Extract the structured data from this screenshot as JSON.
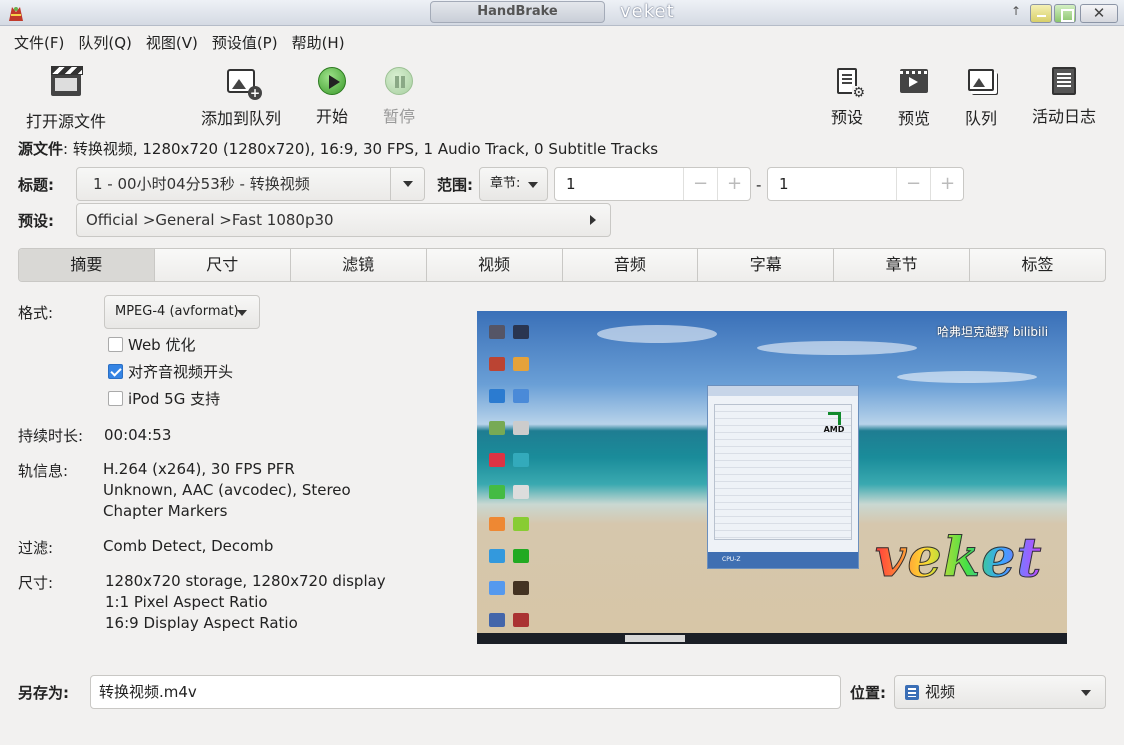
{
  "window": {
    "title": "HandBrake",
    "brand": "veket",
    "close_glyph": "✕",
    "up_glyph": "↑"
  },
  "menu": [
    "文件(F)",
    "队列(Q)",
    "视图(V)",
    "预设值(P)",
    "帮助(H)"
  ],
  "toolbar": {
    "open_source": "打开源文件",
    "add_to_queue": "添加到队列",
    "start": "开始",
    "pause": "暂停",
    "presets": "预设",
    "preview": "预览",
    "queue": "队列",
    "activity_log": "活动日志"
  },
  "source": {
    "label": "源文件",
    "info": ": 转换视频, 1280x720 (1280x720), 16:9, 30 FPS, 1 Audio Track, 0 Subtitle Tracks"
  },
  "title_row": {
    "label": "标题:",
    "value": "1 - 00小时04分53秒 - 转换视频",
    "range_label": "范围:",
    "range_mode": "章节:",
    "range_start": "1",
    "range_end": "1",
    "range_sep": "-",
    "minus": "−",
    "plus": "+"
  },
  "preset_row": {
    "label": "预设:",
    "value": "Official >General >Fast 1080p30"
  },
  "tabs": [
    "摘要",
    "尺寸",
    "滤镜",
    "视频",
    "音频",
    "字幕",
    "章节",
    "标签"
  ],
  "summary": {
    "format_label": "格式:",
    "format_value": "MPEG-4 (avformat)",
    "web_optimized": "Web 优化",
    "align_av": "对齐音视频开头",
    "ipod": "iPod 5G 支持",
    "duration_label": "持续时长:",
    "duration_value": "00:04:53",
    "tracks_label": "轨信息:",
    "tracks_line1": "H.264 (x264), 30 FPS PFR",
    "tracks_line2": "Unknown, AAC (avcodec), Stereo",
    "tracks_line3": "Chapter Markers",
    "filters_label": "过滤:",
    "filters_value": "Comb Detect, Decomb",
    "size_label": "尺寸:",
    "size_line1": "1280x720 storage, 1280x720 display",
    "size_line2": "1:1 Pixel Aspect Ratio",
    "size_line3": "16:9 Display Aspect Ratio"
  },
  "preview": {
    "watermark": "哈弗坦克越野 bilibili",
    "overlay_text": "veket",
    "cpuz_brand": "AMD",
    "cpuz_footer": "CPU-Z"
  },
  "bottom": {
    "save_label": "另存为:",
    "save_value": "转换视频.m4v",
    "location_label": "位置:",
    "location_value": "视频"
  },
  "colors": {
    "accent": "#3584e4",
    "window_bg": "#f2f1f0",
    "play_green": "#3a9a2a"
  }
}
